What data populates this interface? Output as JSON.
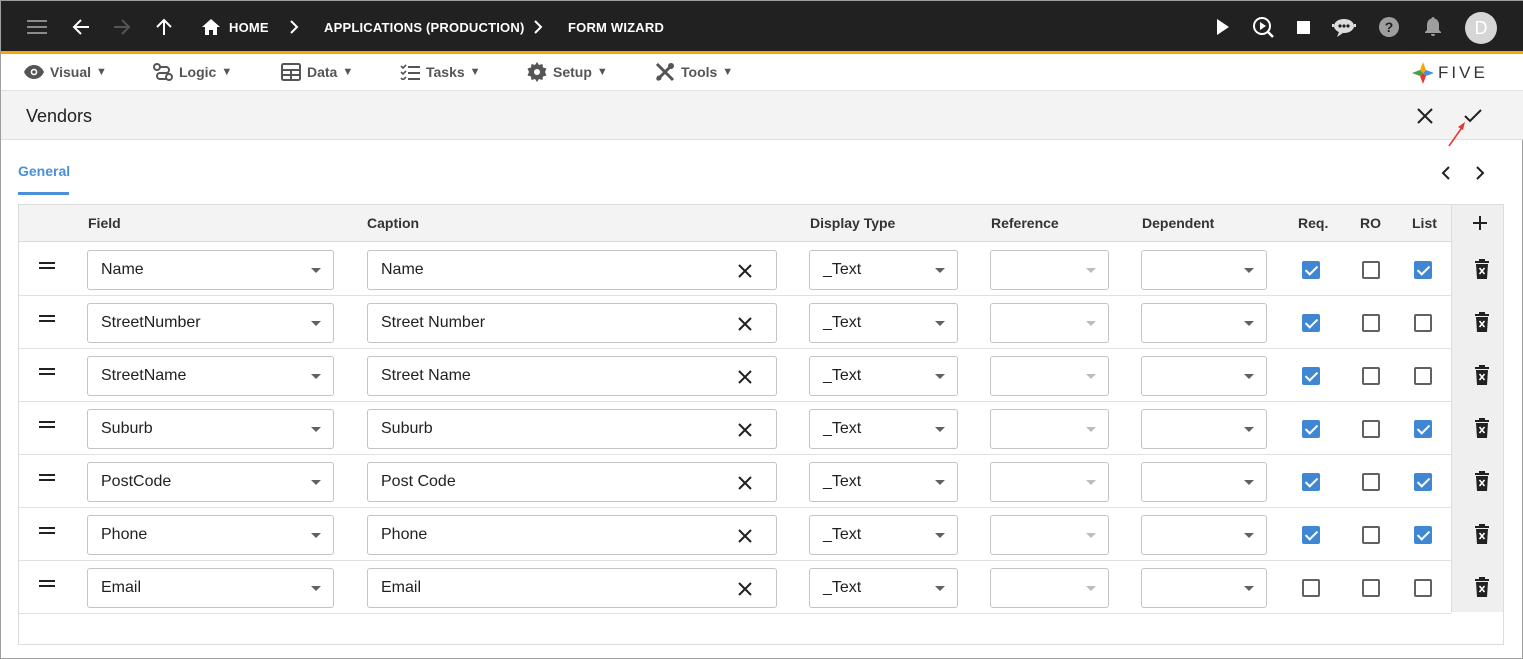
{
  "topbar": {
    "breadcrumbs": [
      "HOME",
      "APPLICATIONS (PRODUCTION)",
      "FORM WIZARD"
    ],
    "avatar_initial": "D",
    "accent_color": "#f5a800"
  },
  "menu": {
    "items": [
      "Visual",
      "Logic",
      "Data",
      "Tasks",
      "Setup",
      "Tools"
    ],
    "caret": "▼",
    "logo_text": "FIVE"
  },
  "form": {
    "title": "Vendors",
    "tab": "General"
  },
  "grid": {
    "columns": [
      "Field",
      "Caption",
      "Display Type",
      "Reference",
      "Dependent",
      "Req.",
      "RO",
      "List"
    ],
    "rows": [
      {
        "field": "Name",
        "caption": "Name",
        "display_type": "_Text",
        "reference": "",
        "dependent": "",
        "req": true,
        "ro": false,
        "list": true
      },
      {
        "field": "StreetNumber",
        "caption": "Street Number",
        "display_type": "_Text",
        "reference": "",
        "dependent": "",
        "req": true,
        "ro": false,
        "list": false
      },
      {
        "field": "StreetName",
        "caption": "Street Name",
        "display_type": "_Text",
        "reference": "",
        "dependent": "",
        "req": true,
        "ro": false,
        "list": false
      },
      {
        "field": "Suburb",
        "caption": "Suburb",
        "display_type": "_Text",
        "reference": "",
        "dependent": "",
        "req": true,
        "ro": false,
        "list": true
      },
      {
        "field": "PostCode",
        "caption": "Post Code",
        "display_type": "_Text",
        "reference": "",
        "dependent": "",
        "req": true,
        "ro": false,
        "list": true
      },
      {
        "field": "Phone",
        "caption": "Phone",
        "display_type": "_Text",
        "reference": "",
        "dependent": "",
        "req": true,
        "ro": false,
        "list": true
      },
      {
        "field": "Email",
        "caption": "Email",
        "display_type": "_Text",
        "reference": "",
        "dependent": "",
        "req": false,
        "ro": false,
        "list": false
      }
    ]
  }
}
